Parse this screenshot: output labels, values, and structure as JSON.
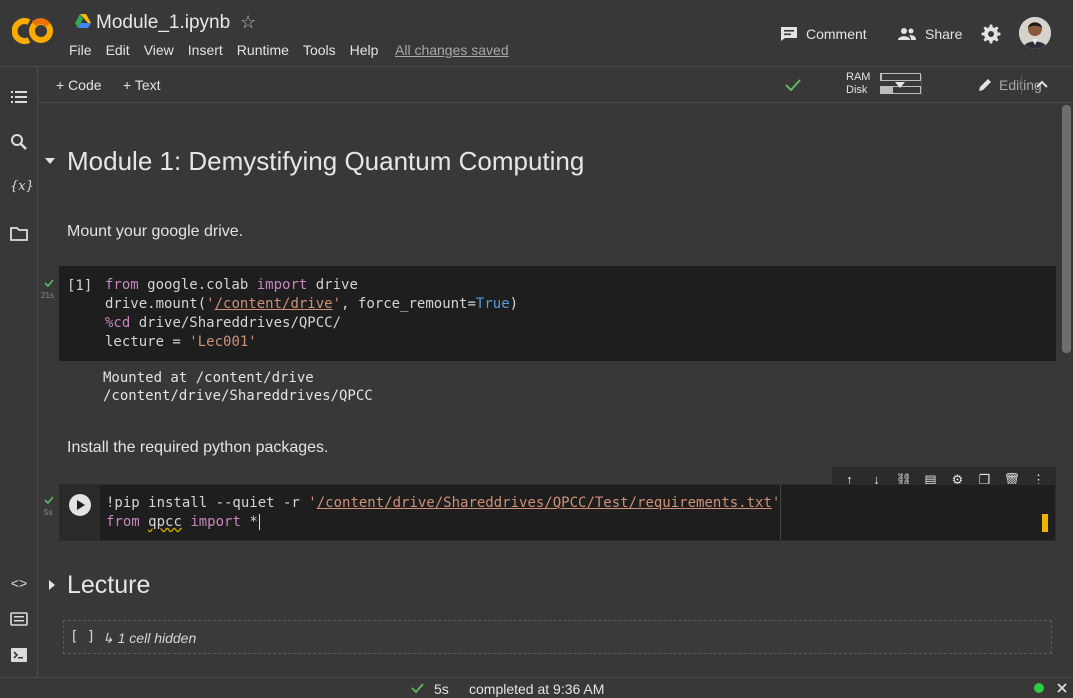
{
  "header": {
    "file_name": "Module_1.ipynb",
    "menu": [
      "File",
      "Edit",
      "View",
      "Insert",
      "Runtime",
      "Tools",
      "Help"
    ],
    "save_status": "All changes saved",
    "comment_label": "Comment",
    "share_label": "Share"
  },
  "toolbar": {
    "add_code_label": "+ Code",
    "add_text_label": "+ Text",
    "ram_label": "RAM",
    "disk_label": "Disk",
    "ram_usage": 0.02,
    "disk_usage": 0.3,
    "editing_label": "Editing"
  },
  "notebook": {
    "heading": "Module 1: Demystifying Quantum Computing",
    "text_mount": "Mount your google drive.",
    "cell1": {
      "exec_count": "[1]",
      "exec_time": "21s",
      "output": [
        "Mounted at /content/drive",
        "/content/drive/Shareddrives/QPCC"
      ]
    },
    "text_install": "Install the required python packages.",
    "cell2": {
      "exec_time": "5s"
    },
    "lecture_heading": "Lecture",
    "hidden_bracket": "[ ]",
    "hidden_text": "↳ 1 cell hidden"
  },
  "status": {
    "duration": "5s",
    "message": "completed at 9:36 AM"
  },
  "colors": {
    "background": "#383838",
    "code_background": "#1e1e1e",
    "accent_green": "#5fb85f",
    "cursor_yellow": "#f0b400"
  }
}
